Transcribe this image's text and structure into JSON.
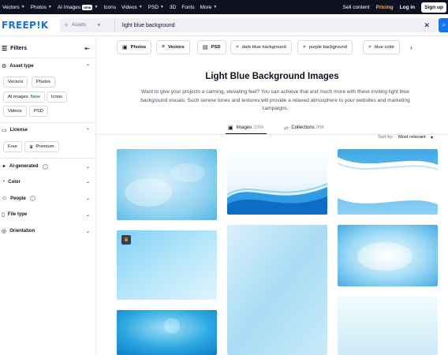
{
  "topnav": {
    "items": [
      {
        "label": "Vectors",
        "has_caret": true
      },
      {
        "label": "Photos",
        "has_caret": true
      },
      {
        "label": "AI Images",
        "badge": "NEW",
        "has_caret": true
      },
      {
        "label": "Icons",
        "has_caret": false
      },
      {
        "label": "Videos",
        "has_caret": true
      },
      {
        "label": "PSD",
        "has_caret": true
      },
      {
        "label": "3D",
        "has_caret": false
      },
      {
        "label": "Fonts",
        "has_caret": false
      },
      {
        "label": "More",
        "has_caret": true
      }
    ],
    "sell_content": "Sell content",
    "pricing": "Pricing",
    "login": "Log in",
    "signup": "Sign up"
  },
  "header": {
    "logo": "FREEP!K",
    "asset_selector": "Assets",
    "search_value": "light blue background",
    "clear_icon": "close-icon",
    "search_icon": "search-icon"
  },
  "sidebar": {
    "title": "Filters",
    "asset_type": {
      "title": "Asset type",
      "chips": [
        "Vectors",
        "Photos",
        "AI images",
        "Icons",
        "Videos",
        "PSD"
      ],
      "ai_new": "New"
    },
    "license": {
      "title": "License",
      "chips": [
        "Free",
        "Premium"
      ]
    },
    "sections": [
      "AI-generated",
      "Color",
      "People",
      "File type",
      "Orientation"
    ]
  },
  "chips": [
    {
      "label": "Photos",
      "icon": "image-icon"
    },
    {
      "label": "Vectors",
      "icon": "vector-icon"
    },
    {
      "label": "PSD",
      "icon": "psd-icon"
    },
    {
      "label": "dark blue background",
      "icon": "search-icon"
    },
    {
      "label": "purple background",
      "icon": "search-icon"
    },
    {
      "label": "blue color",
      "icon": "search-icon"
    }
  ],
  "main": {
    "title": "Light Blue Background Images",
    "description": "Want to give your projects a calming, elevating feel? You can achieve that and much more with these inviting light blue background visuals. Such serene tones and textures will provide a relaxed atmosphere to your websites and marketing campaigns.",
    "tabs": [
      {
        "label": "Images",
        "count": "100k",
        "active": true
      },
      {
        "label": "Collections",
        "count": "906",
        "active": false
      }
    ],
    "sort_label": "Sort by:",
    "sort_value": "Most relevant"
  },
  "colors": {
    "topnav_bg": "#0e1122",
    "brand_blue": "#1273eb",
    "pricing": "#ffb74a",
    "new_green": "#1b9e5a"
  }
}
